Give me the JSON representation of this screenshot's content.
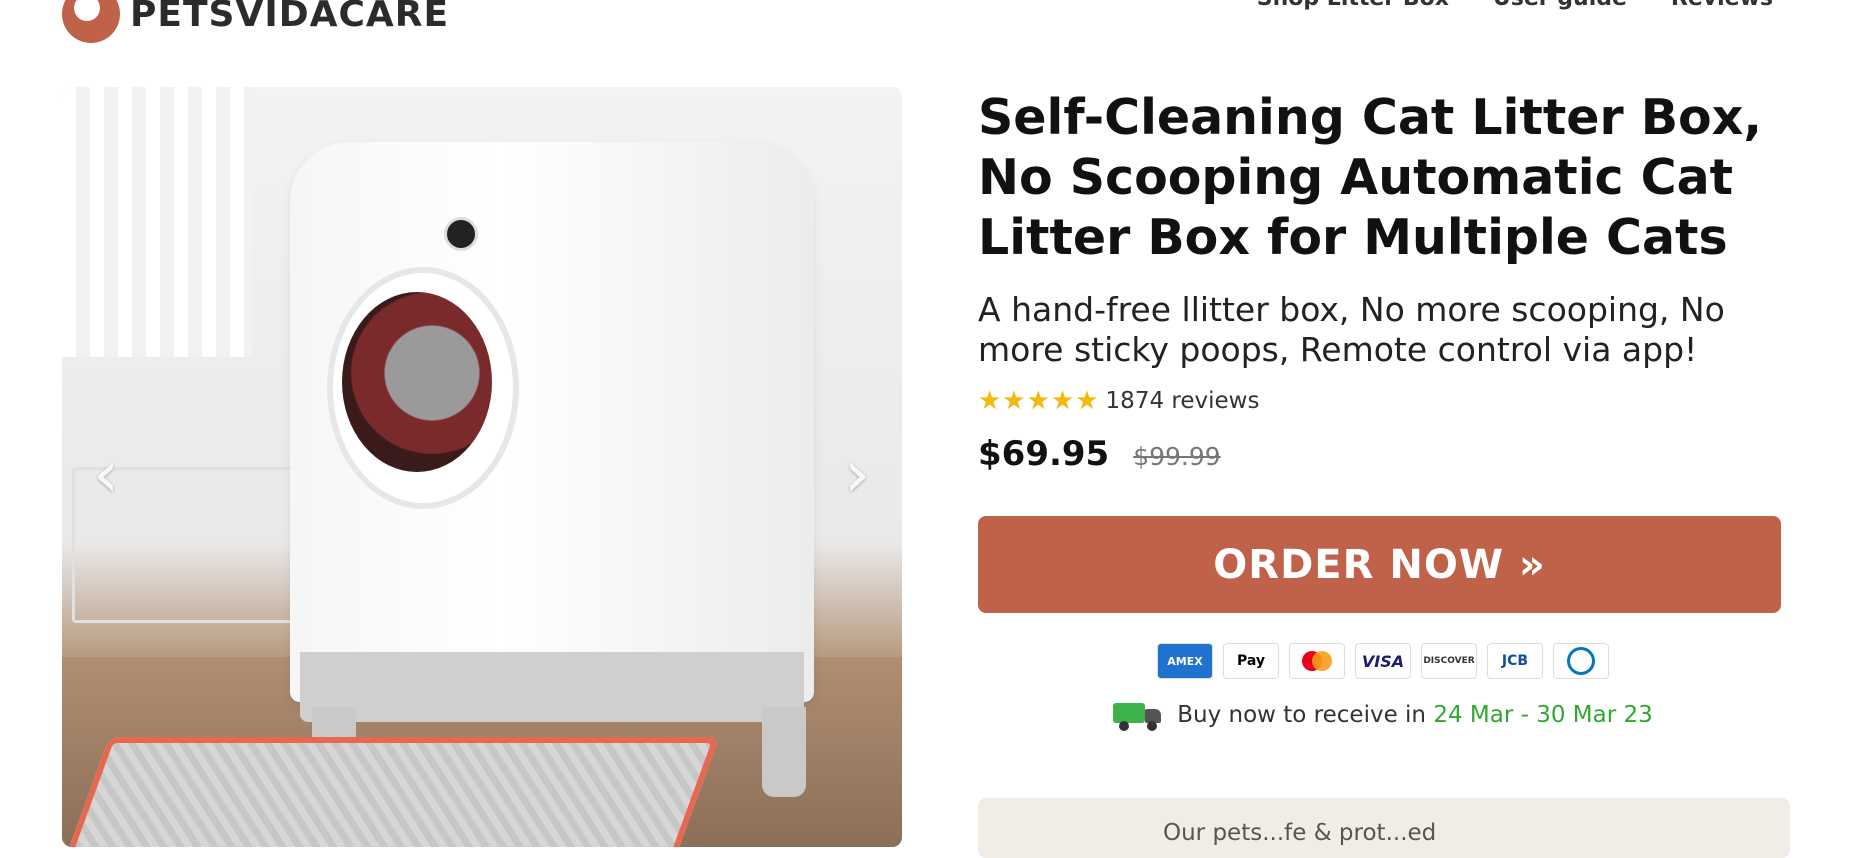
{
  "header": {
    "logo_text": "PETSVIDACARE",
    "nav": [
      "Shop Litter Box",
      "User guide",
      "Reviews"
    ]
  },
  "gallery": {
    "prev_icon": "‹",
    "next_icon": "›"
  },
  "product": {
    "title": "Self-Cleaning Cat Litter Box, No Scooping Automatic Cat Litter Box for Multiple Cats",
    "subtitle": "A hand-free llitter box, No more scooping, No more sticky poops, Remote control via app!",
    "stars": "★★★★★",
    "rating_fraction": 1.0,
    "reviews": "1874 reviews",
    "price": "$69.95",
    "price_old": "$99.99",
    "order_label": "ORDER NOW »",
    "payments": {
      "amex": "AMEX",
      "apple": "Pay",
      "visa": "VISA",
      "discover": "DISCOVER",
      "jcb": "JCB"
    },
    "delivery_prefix": "Buy now to receive in ",
    "delivery_dates": "24 Mar - 30 Mar 23",
    "guarantee": "Our pets...fe & prot...ed"
  },
  "colors": {
    "accent": "#c0614a",
    "star": "#f2b90f",
    "delivery_green": "#2fa82f"
  }
}
